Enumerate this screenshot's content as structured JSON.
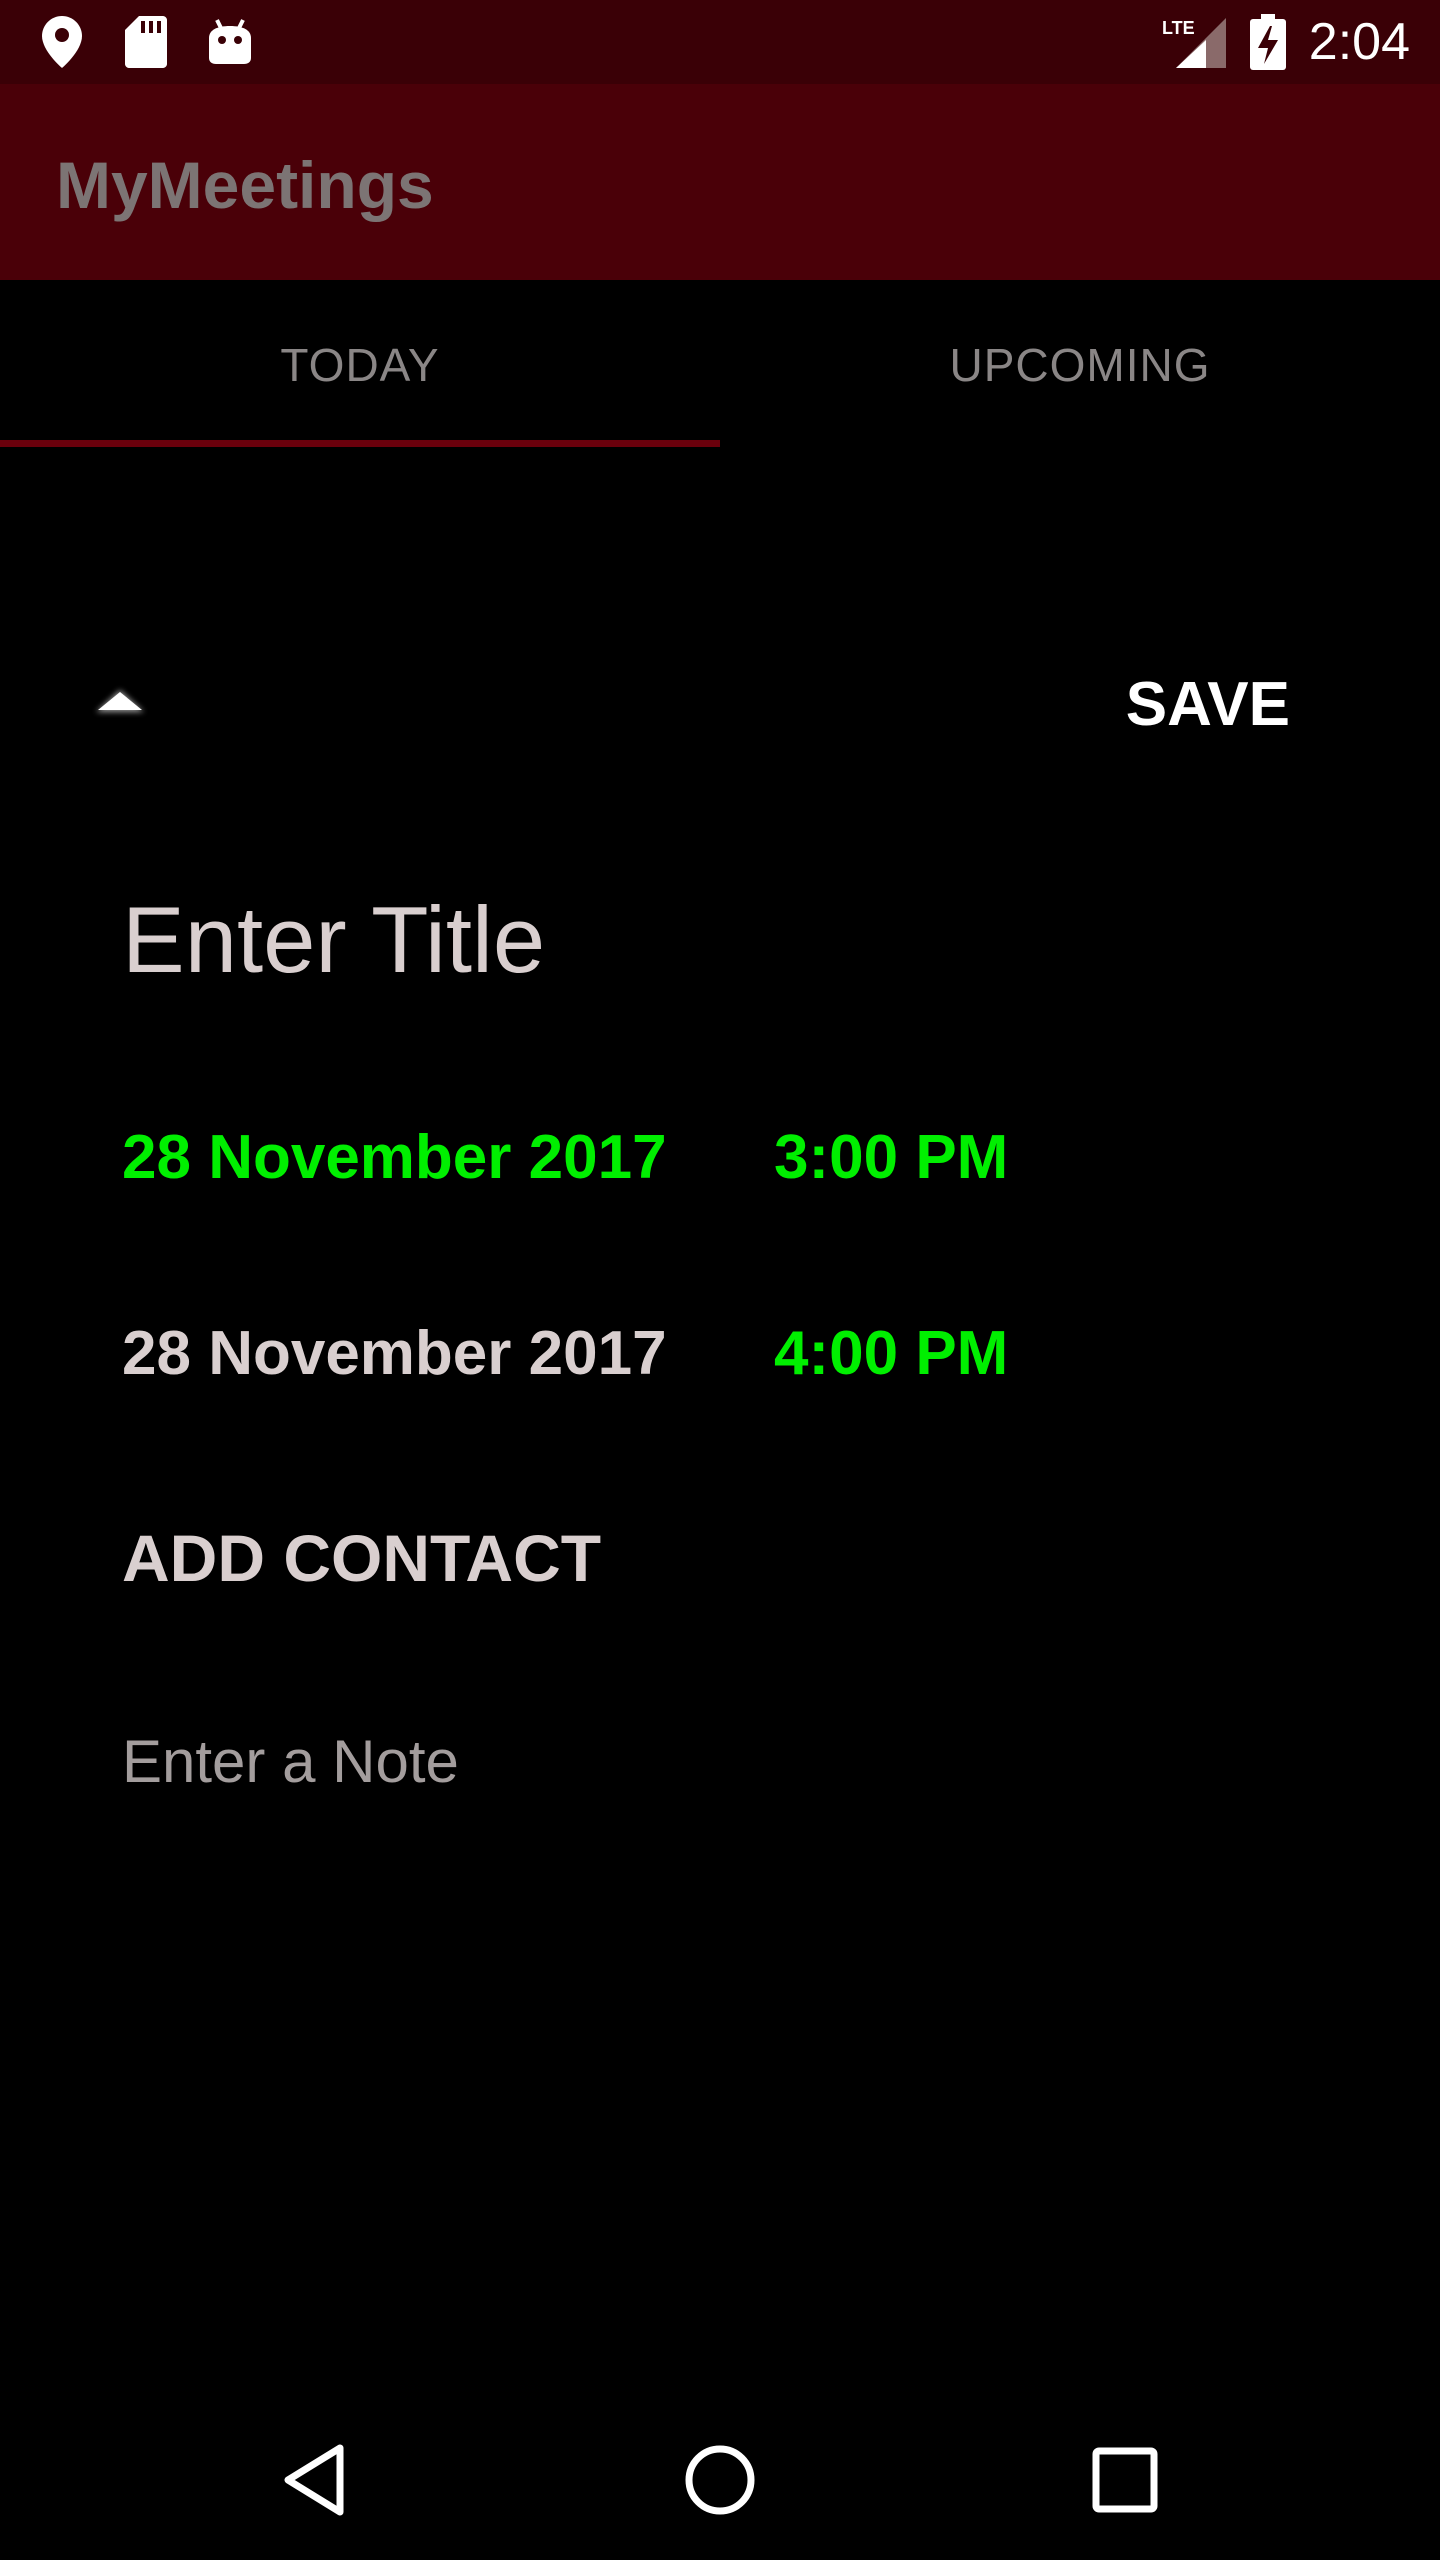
{
  "status_bar": {
    "time": "2:04",
    "network": "LTE",
    "icons": [
      "location-icon",
      "sd-card-icon",
      "android-icon",
      "signal-icon",
      "battery-charging-icon"
    ]
  },
  "app_bar": {
    "title": "MyMeetings"
  },
  "tabs": [
    {
      "label": "TODAY",
      "selected": true
    },
    {
      "label": "UPCOMING",
      "selected": false
    }
  ],
  "form": {
    "save_label": "SAVE",
    "title_placeholder": "Enter Title",
    "start": {
      "date": "28 November 2017",
      "time": "3:00 PM"
    },
    "end": {
      "date": "28 November 2017",
      "time": "4:00 PM"
    },
    "add_contact_label": "ADD CONTACT",
    "note_placeholder": "Enter a Note"
  },
  "colors": {
    "status_bar": "#3a0006",
    "app_bar": "#4a0008",
    "tab_indicator": "#6a000c",
    "accent_green": "#00ef00",
    "text": "#d9cfcf"
  }
}
